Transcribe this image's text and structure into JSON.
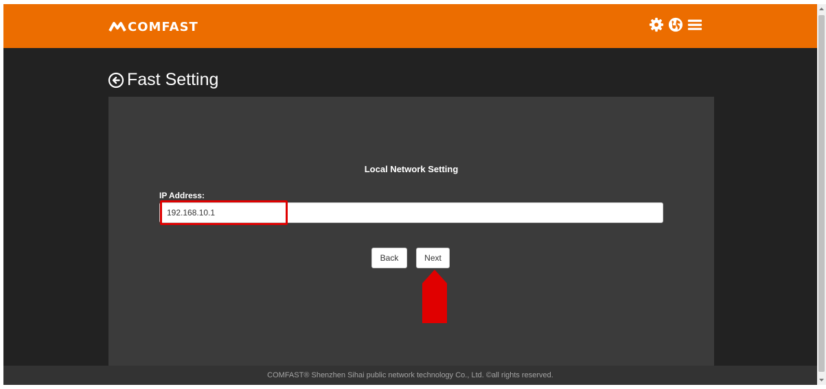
{
  "header": {
    "brand": "COMFAST",
    "brand_color": "#ec6d00",
    "icons": [
      "gear-icon",
      "globe-icon",
      "menu-icon"
    ]
  },
  "page": {
    "title": "Fast Setting",
    "back_icon": "circle-arrow-left-icon"
  },
  "form": {
    "section_title": "Local Network Setting",
    "ip_label": "IP Address:",
    "ip_value": "192.168.10.1"
  },
  "buttons": {
    "back": "Back",
    "next": "Next"
  },
  "annotations": {
    "highlight_color": "#e00000"
  },
  "footer": {
    "text": "COMFAST® Shenzhen Sihai public network technology Co., Ltd. ©all rights reserved."
  }
}
